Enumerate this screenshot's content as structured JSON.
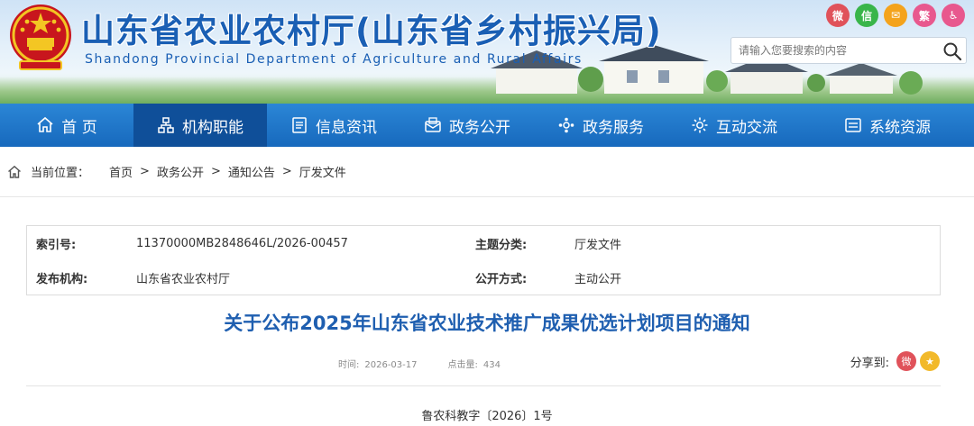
{
  "header": {
    "title": "山东省农业农村厅(山东省乡村振兴局)",
    "subtitle": "Shandong Provincial Department of Agriculture and Rural Affairs",
    "social": [
      {
        "icon": "weibo-icon",
        "glyph": "微",
        "color": "#e0525a"
      },
      {
        "icon": "wechat-icon",
        "glyph": "信",
        "color": "#39b54a"
      },
      {
        "icon": "mail-icon",
        "glyph": "✉",
        "color": "#f4a31c"
      },
      {
        "icon": "traditional-chinese-icon",
        "glyph": "繁",
        "color": "#e8588e"
      },
      {
        "icon": "accessibility-icon",
        "glyph": "♿",
        "color": "#e8588e"
      }
    ],
    "search_placeholder": "请输入您要搜索的内容"
  },
  "nav": {
    "items": [
      {
        "label": "首 页",
        "icon": "home-icon"
      },
      {
        "label": "机构职能",
        "icon": "org-icon"
      },
      {
        "label": "信息资讯",
        "icon": "news-icon"
      },
      {
        "label": "政务公开",
        "icon": "public-affairs-icon"
      },
      {
        "label": "政务服务",
        "icon": "service-icon"
      },
      {
        "label": "互动交流",
        "icon": "interaction-icon"
      },
      {
        "label": "系统资源",
        "icon": "system-icon"
      }
    ],
    "active_index": 1
  },
  "breadcrumb": {
    "label": "当前位置：",
    "items": [
      "首页",
      "政务公开",
      "通知公告",
      "厅发文件"
    ],
    "separator": ">"
  },
  "meta": {
    "index_key": "索引号:",
    "index_value": "11370000MB2848646L/2026-00457",
    "topic_key": "主题分类:",
    "topic_value": "厅发文件",
    "org_key": "发布机构:",
    "org_value": "山东省农业农村厅",
    "open_key": "公开方式:",
    "open_value": "主动公开"
  },
  "article": {
    "title": "关于公布2025年山东省农业技术推广成果优选计划项目的通知",
    "time_label": "时间:",
    "time_value": "2026-03-17",
    "clicks_label": "点击量:",
    "clicks_value": "434",
    "share_label": "分享到:",
    "doc_number": "鲁农科教字〔2026〕1号"
  },
  "colors": {
    "brand_blue": "#1a5fb4",
    "nav_blue": "#1769bd",
    "nav_active": "#0f4f99"
  }
}
